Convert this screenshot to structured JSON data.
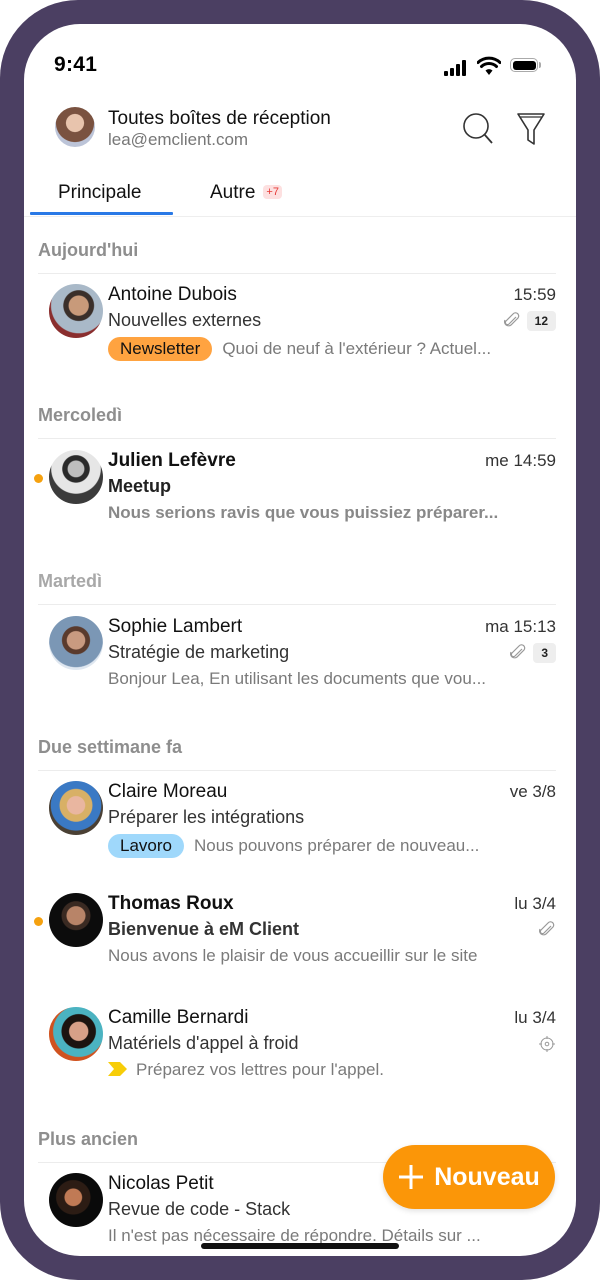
{
  "status_bar": {
    "time": "9:41"
  },
  "header": {
    "title": "Toutes boîtes de réception",
    "email": "lea@emclient.com",
    "search_icon": "search-icon",
    "filter_icon": "filter-icon"
  },
  "tabs": [
    {
      "label": "Principale",
      "active": true
    },
    {
      "label": "Autre",
      "badge": "+7",
      "active": false
    }
  ],
  "sections": [
    {
      "label": "Aujourd'hui"
    },
    {
      "label": "Mercoledì"
    },
    {
      "label": "Martedì"
    },
    {
      "label": "Due settimane fa"
    },
    {
      "label": "Plus ancien"
    }
  ],
  "messages": [
    {
      "from": "Antoine Dubois",
      "date": "15:59",
      "subject": "Nouvelles externes",
      "tag": "Newsletter",
      "preview": "Quoi de neuf à l'extérieur ? Actuel...",
      "attachment": true,
      "count": "12",
      "unread": false
    },
    {
      "from": "Julien Lefèvre",
      "date": "me 14:59",
      "subject": "Meetup",
      "preview": "Nous serions ravis que vous puissiez préparer...",
      "unread": true
    },
    {
      "from": "Sophie Lambert",
      "date": "ma 15:13",
      "subject": "Stratégie de marketing",
      "preview": "Bonjour Lea, En utilisant les documents que vou...",
      "attachment": true,
      "count": "3",
      "unread": false
    },
    {
      "from": "Claire Moreau",
      "date": "ve 3/8",
      "subject": "Préparer les intégrations",
      "tag": "Lavoro",
      "preview": "Nous pouvons préparer de nouveau...",
      "unread": false
    },
    {
      "from": "Thomas Roux",
      "date": "lu 3/4",
      "subject": "Bienvenue à eM Client",
      "preview": "Nous avons le plaisir de vous accueillir sur le site",
      "attachment": true,
      "unread": true
    },
    {
      "from": "Camille Bernardi",
      "date": "lu 3/4",
      "subject": "Matériels d'appel à froid",
      "preview": "Préparez vos lettres pour l'appel.",
      "target_icon": true,
      "flag": "yellow",
      "unread": false
    },
    {
      "from": "Nicolas Petit",
      "date": "",
      "subject": "Revue de code - Stack",
      "preview": "Il n'est pas nécessaire de répondre. Détails sur ...",
      "unread": false
    }
  ],
  "fab": {
    "label": "Nouveau",
    "icon": "plus-icon"
  },
  "colors": {
    "frame": "#4b3f62",
    "accent": "#2979e6",
    "unread_dot": "#f5a10f",
    "fab": "#fb9608",
    "tag_newsletter": "#ffa340",
    "tag_lavoro": "#9fd8fb",
    "flag": "#f7cd08"
  }
}
